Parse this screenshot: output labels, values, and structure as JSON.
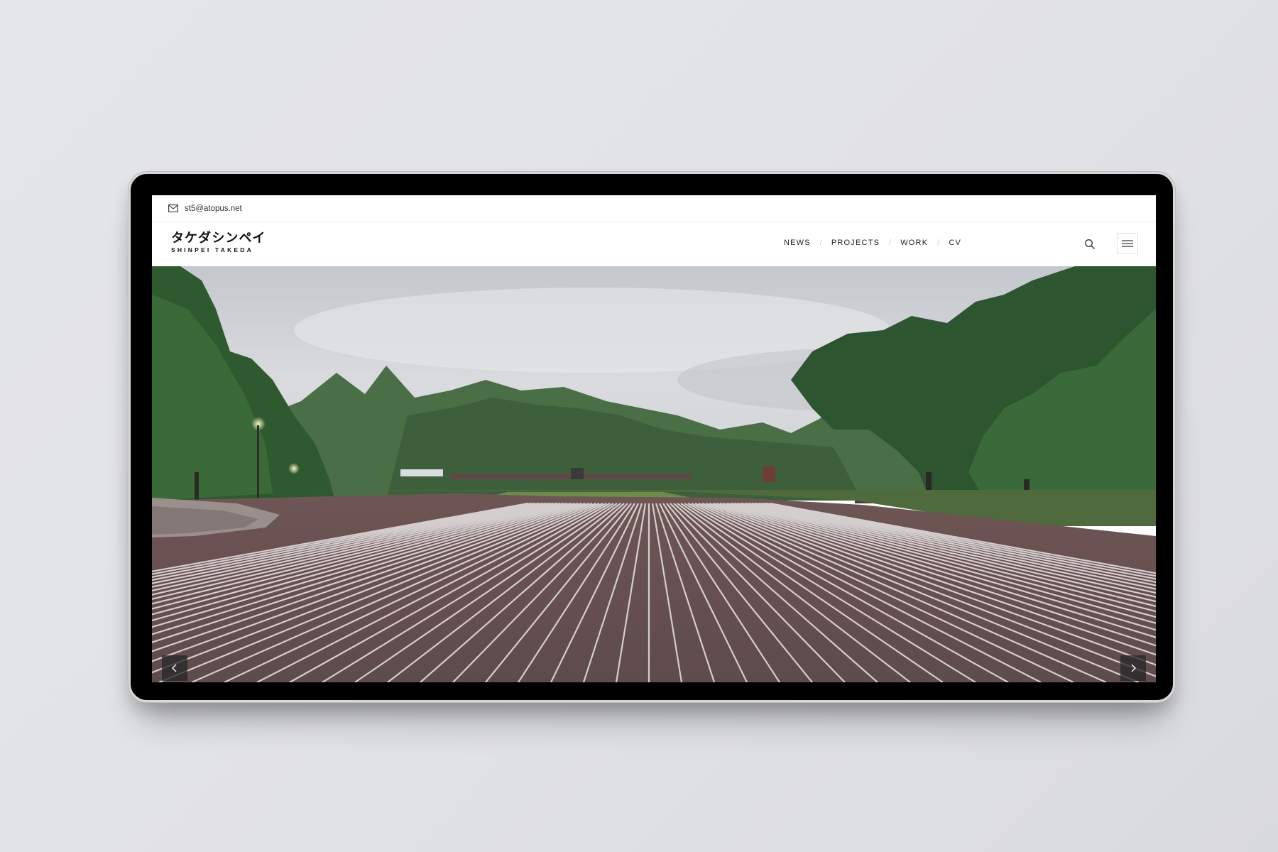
{
  "topbar": {
    "email": "st5@atopus.net"
  },
  "logo": {
    "japanese": "タケダシンペイ",
    "english": "SHINPEI TAKEDA"
  },
  "nav": {
    "items": [
      "NEWS",
      "PROJECTS",
      "WORK",
      "CV"
    ],
    "separator": "/"
  },
  "hero": {
    "image": "Brick-paved plaza with white chalk lines, surrounded by trees under an overcast sky"
  },
  "icons": {
    "mail": "mail-icon",
    "search": "search-icon",
    "menu": "hamburger-menu-icon",
    "prev": "chevron-left-icon",
    "next": "chevron-right-icon"
  },
  "colors": {
    "page_bg": "#e2e3e7",
    "device_frame": "#000000",
    "text": "#222222",
    "arrow_bg": "#2a2a2a"
  }
}
